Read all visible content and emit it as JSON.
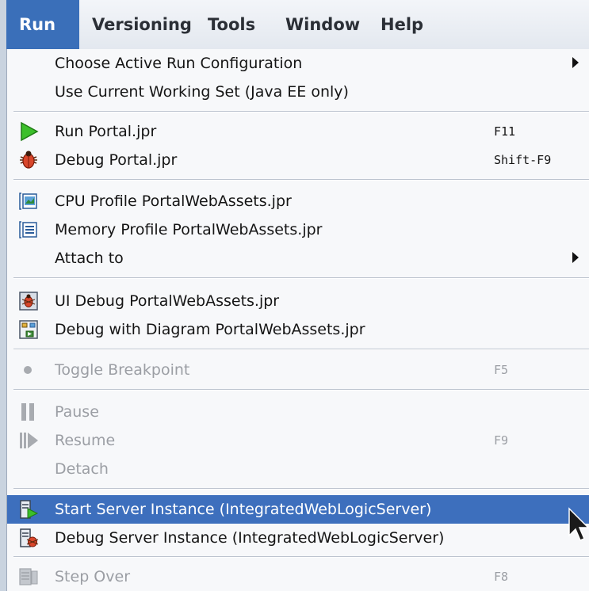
{
  "menubar": {
    "items": [
      {
        "label": "Run",
        "mnemonic": "R",
        "active": true
      },
      {
        "label": "Versioning",
        "mnemonic": "i"
      },
      {
        "label": "Tools",
        "mnemonic": "T"
      },
      {
        "label": "Window",
        "mnemonic": "W"
      },
      {
        "label": "Help",
        "mnemonic": "H"
      }
    ]
  },
  "run_menu": {
    "items": [
      {
        "label": "Choose Active Run Configuration",
        "has_submenu": true
      },
      {
        "label": "Use Current Working Set (Java EE only)"
      },
      {
        "label": "Run Portal.jpr",
        "shortcut": "F11",
        "icon": "run-triangle-icon"
      },
      {
        "label": "Debug Portal.jpr",
        "shortcut": "Shift-F9",
        "icon": "bug-icon"
      },
      {
        "label": "CPU Profile PortalWebAssets.jpr",
        "icon": "cpu-profile-icon"
      },
      {
        "label": "Memory Profile PortalWebAssets.jpr",
        "icon": "memory-profile-icon"
      },
      {
        "label": "Attach to",
        "has_submenu": true
      },
      {
        "label": "UI Debug PortalWebAssets.jpr",
        "icon": "ui-debug-icon"
      },
      {
        "label": "Debug with Diagram PortalWebAssets.jpr",
        "icon": "diagram-debug-icon"
      },
      {
        "label": "Toggle Breakpoint",
        "shortcut": "F5",
        "icon": "breakpoint-dot-icon",
        "disabled": true
      },
      {
        "label": "Pause",
        "icon": "pause-icon",
        "disabled": true
      },
      {
        "label": "Resume",
        "shortcut": "F9",
        "icon": "resume-icon",
        "disabled": true
      },
      {
        "label": "Detach",
        "disabled": true
      },
      {
        "label": "Start Server Instance (IntegratedWebLogicServer)",
        "icon": "start-server-icon",
        "selected": true
      },
      {
        "label": "Debug Server Instance (IntegratedWebLogicServer)",
        "icon": "debug-server-icon"
      },
      {
        "label": "Step Over",
        "shortcut": "F8",
        "icon": "step-over-icon",
        "disabled": true
      }
    ]
  },
  "colors": {
    "selection": "#3d6fbd",
    "menu_bg": "#f7f8fa",
    "disabled_text": "#9b9ea4",
    "run_green": "#3cbf2a",
    "bug_red": "#d9462b"
  }
}
